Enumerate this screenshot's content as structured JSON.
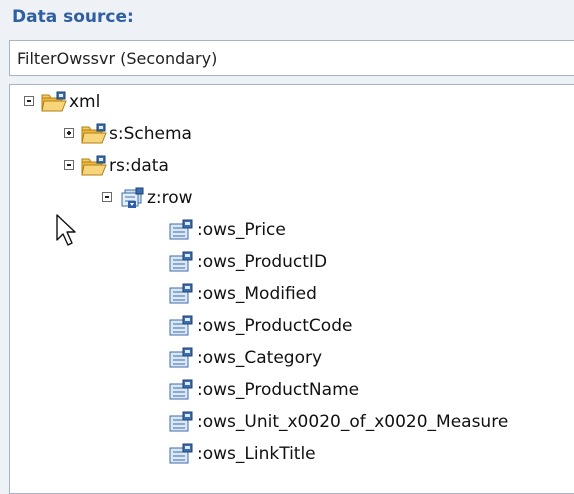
{
  "panel": {
    "label": "Data source:"
  },
  "datasource": {
    "value": "FilterOwssvr (Secondary)"
  },
  "tree": {
    "root": {
      "label": "xml",
      "icon": "folder-lock-icon",
      "expanded": true
    },
    "schema": {
      "label": "s:Schema",
      "icon": "folder-lock-icon",
      "expanded": false
    },
    "data": {
      "label": "rs:data",
      "icon": "folder-lock-icon",
      "expanded": true
    },
    "row": {
      "label": "z:row",
      "icon": "repeating-group-icon",
      "expanded": true
    },
    "fields": [
      {
        "label": ":ows_Price",
        "icon": "field-lock-icon"
      },
      {
        "label": ":ows_ProductID",
        "icon": "field-lock-icon"
      },
      {
        "label": ":ows_Modified",
        "icon": "field-lock-icon"
      },
      {
        "label": ":ows_ProductCode",
        "icon": "field-lock-icon"
      },
      {
        "label": ":ows_Category",
        "icon": "field-lock-icon"
      },
      {
        "label": ":ows_ProductName",
        "icon": "field-lock-icon"
      },
      {
        "label": ":ows_Unit_x0020_of_x0020_Measure",
        "icon": "field-lock-icon"
      },
      {
        "label": ":ows_LinkTitle",
        "icon": "field-lock-icon"
      }
    ]
  },
  "colors": {
    "label_blue": "#2f5fa0",
    "panel_bg": "#eef1f6",
    "border": "#a8b4c6",
    "folder": "#f0b73c"
  }
}
